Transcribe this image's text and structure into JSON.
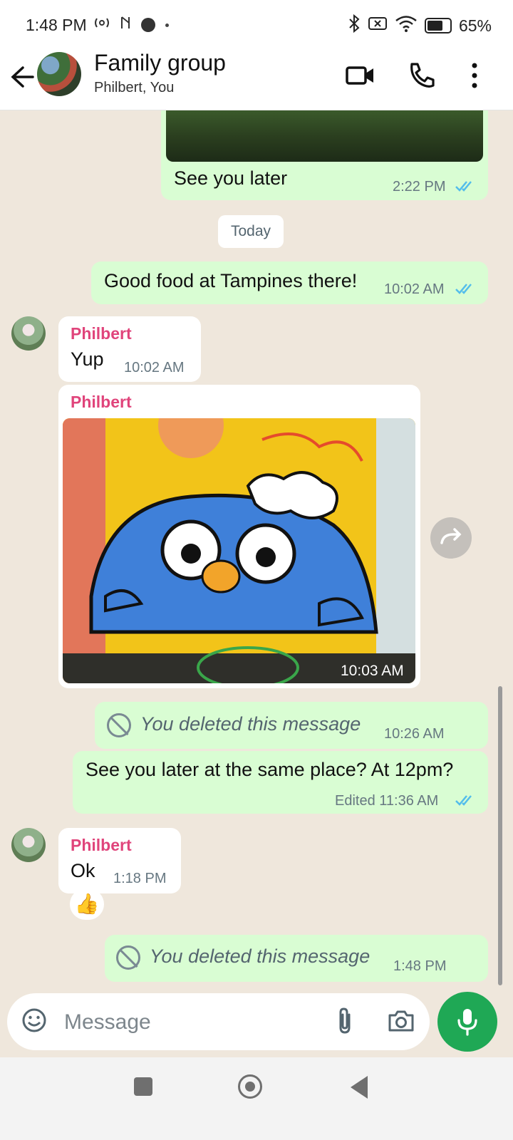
{
  "status_bar": {
    "time": "1:48 PM",
    "left_icons": [
      "radio-icon",
      "nfc-icon",
      "record-dot-icon",
      "small-dot-icon"
    ],
    "right_icons": [
      "bluetooth-icon",
      "no-sim-icon",
      "wifi-icon",
      "battery-icon"
    ],
    "battery": "65%",
    "battery_level": 0.65
  },
  "header": {
    "title": "Family group",
    "subtitle": "Philbert, You",
    "actions": [
      "video-call-icon",
      "voice-call-icon",
      "more-options-icon"
    ]
  },
  "messages": {
    "m1": {
      "text": "See you later",
      "time": "2:22 PM",
      "status": "read"
    },
    "date_divider": "Today",
    "m2": {
      "text": "Good food at Tampines there!",
      "time": "10:02 AM",
      "status": "read"
    },
    "m3": {
      "sender": "Philbert",
      "text": "Yup",
      "time": "10:02 AM"
    },
    "m4": {
      "sender": "Philbert",
      "time": "10:03 AM",
      "media": "sticker photo"
    },
    "m5": {
      "text": "You deleted this message",
      "time": "10:26 AM"
    },
    "m6": {
      "text": "See you later at the same place? At 12pm?",
      "time": "Edited 11:36 AM",
      "status": "read"
    },
    "m7": {
      "sender": "Philbert",
      "text": "Ok",
      "time": "1:18 PM",
      "reaction": "👍"
    },
    "m8": {
      "text": "You deleted this message",
      "time": "1:48 PM"
    }
  },
  "composer": {
    "placeholder": "Message",
    "icons": [
      "emoji-icon",
      "attach-icon",
      "camera-icon",
      "mic-icon"
    ]
  },
  "colors": {
    "outgoing": "#d9fdd3",
    "incoming": "#ffffff",
    "sender_name": "#e0447b",
    "read_ticks": "#53bdeb",
    "mic_button": "#1fa855",
    "chat_bg": "#efe7dc"
  }
}
